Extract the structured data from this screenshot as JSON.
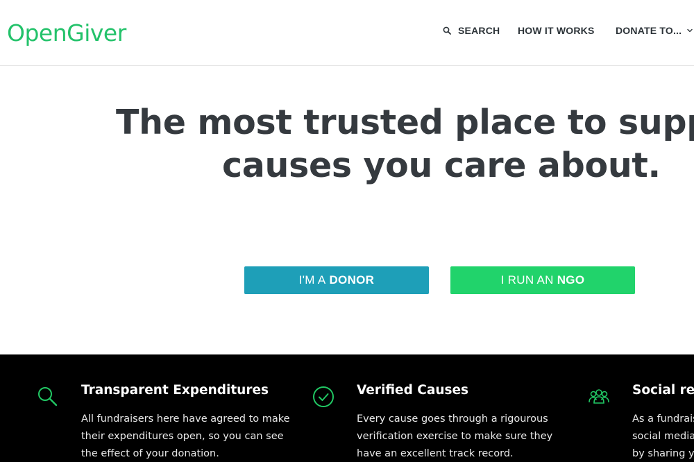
{
  "brand": {
    "logo_text": "OpenGiver",
    "accent": "#23c26a"
  },
  "nav": {
    "search_label": "SEARCH",
    "how_label": "HOW IT WORKS",
    "donate_label": "DONATE TO...",
    "search_icon": "search-icon",
    "donate_icon": "chevron-down-icon"
  },
  "hero": {
    "line1": "The most trusted place to supp",
    "line2": "causes you care about."
  },
  "buttons": {
    "donor_prefix": "I'M A",
    "donor_strong": "DONOR",
    "donor_color": "#1e9fb8",
    "ngo_prefix": "I RUN AN",
    "ngo_strong": "NGO",
    "ngo_color": "#21d36b"
  },
  "features": [
    {
      "icon": "search-icon",
      "title": "Transparent Expenditures",
      "lines": [
        "All fundraisers here have agreed to make",
        "their expenditures open, so you can see",
        "the effect of your donation."
      ]
    },
    {
      "icon": "check-circle-icon",
      "title": "Verified Causes",
      "lines": [
        "Every cause goes through a rigourous",
        "verification exercise to make sure they",
        "have an excellent track record."
      ]
    },
    {
      "icon": "people-group-icon",
      "title": "Social rea",
      "lines": [
        "As a fundrais",
        "social media",
        "by sharing y"
      ]
    }
  ]
}
